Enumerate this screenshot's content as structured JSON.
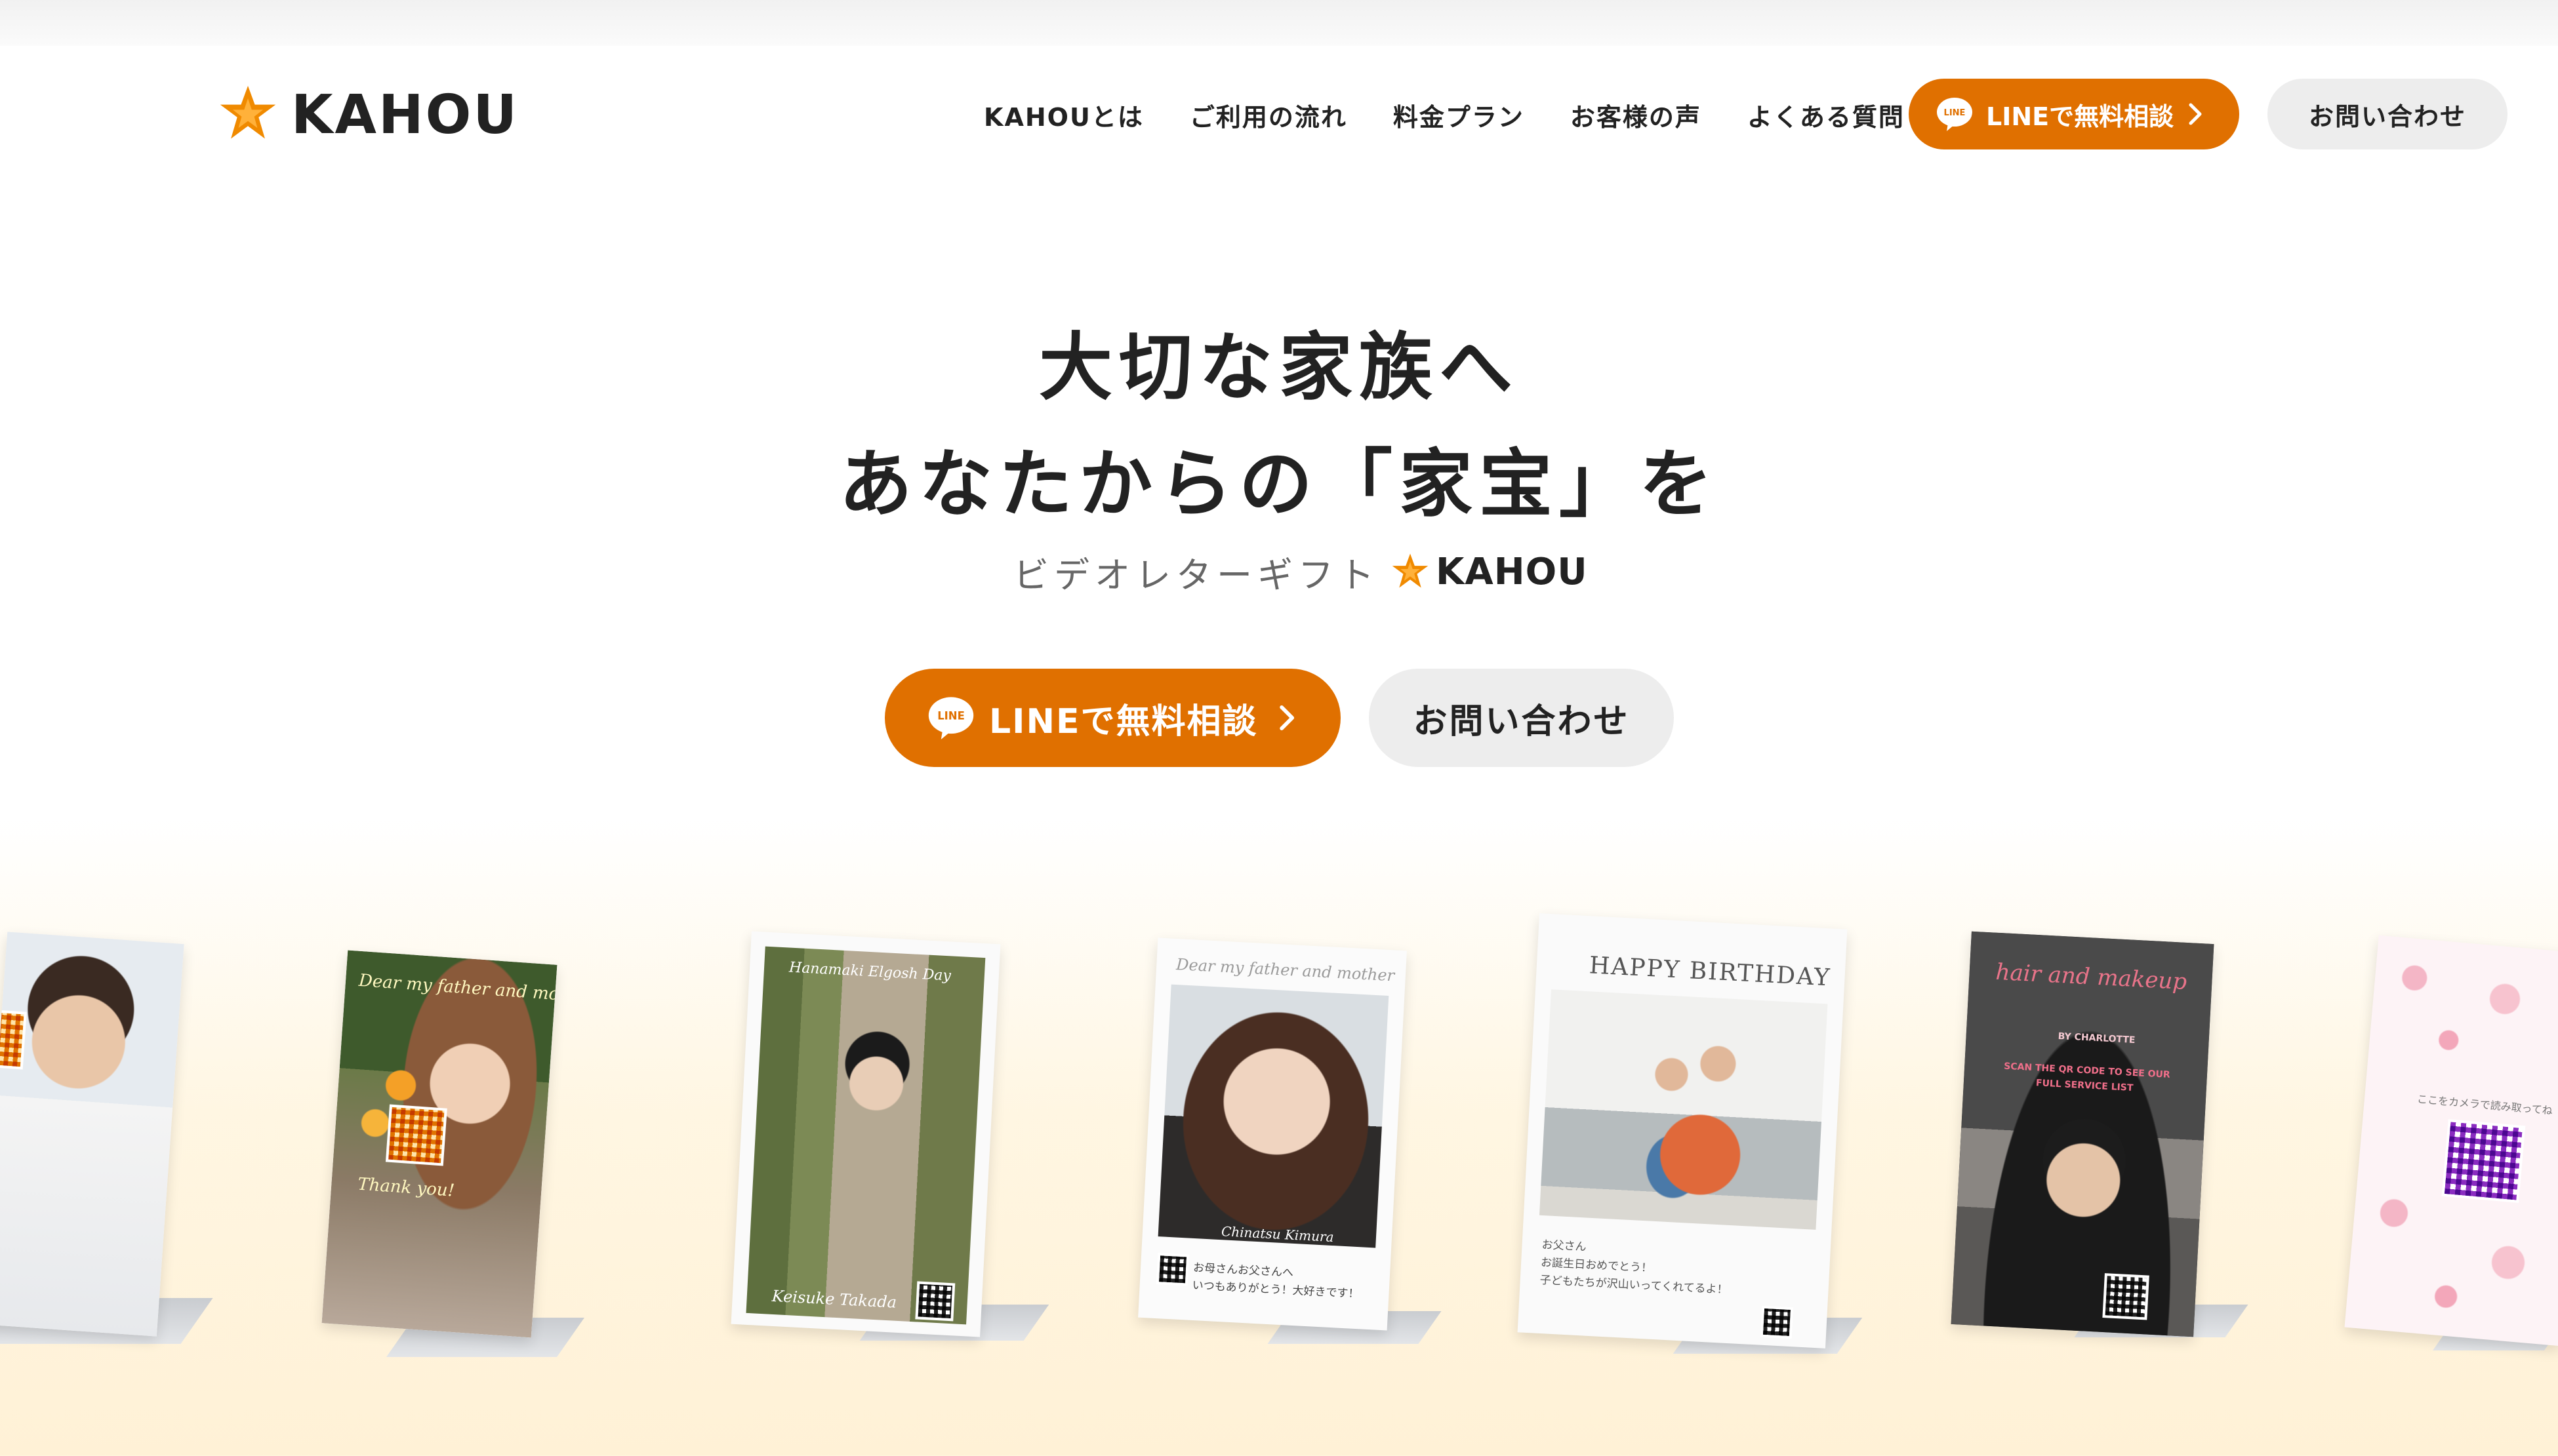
{
  "header": {
    "logo_text": "KAHOU",
    "nav": [
      "KAHOUとは",
      "ご利用の流れ",
      "料金プラン",
      "お客様の声",
      "よくある質問"
    ],
    "line_button": "LINEで無料相談",
    "line_badge": "LINE",
    "contact_button": "お問い合わせ"
  },
  "hero": {
    "title_line1": "大切な家族へ",
    "title_line2": "あなたからの「家宝」を",
    "subtitle": "ビデオレターギフト",
    "subtitle_logo": "KAHOU",
    "line_button": "LINEで無料相談",
    "line_badge": "LINE",
    "contact_button": "お問い合わせ"
  },
  "cards": {
    "c2_script1": "Dear my father and mother",
    "c2_script2": "Thank you!",
    "c3_top": "Hanamaki Elgosh Day",
    "c3_name": "Keisuke Takada",
    "c4_script": "Dear my father and mother",
    "c4_name": "Chinatsu Kimura",
    "c4_msg1": "お母さんお父さんへ",
    "c4_msg2": "いつもありがとう！大好きです！",
    "c5_title": "HAPPY  BIRTHDAY",
    "c5_msg1": "お父さん",
    "c5_msg2": "お誕生日おめでとう！",
    "c5_msg3": "子どもたちが沢山いってくれてるよ！",
    "c6_script": "hair and makeup",
    "c6_by": "BY CHARLOTTE",
    "c6_scan1": "SCAN THE QR CODE TO SEE OUR",
    "c6_scan2": "FULL SERVICE LIST",
    "c7_text": "ここをカメラで読み取ってね"
  },
  "colors": {
    "accent": "#e07000",
    "line_green_badge": "#ffffff",
    "contact_bg": "#ededed",
    "text": "#222222"
  },
  "icons": {
    "logo": "star-burst-logo-icon",
    "line": "line-chat-icon",
    "chevron": "chevron-right-icon"
  }
}
